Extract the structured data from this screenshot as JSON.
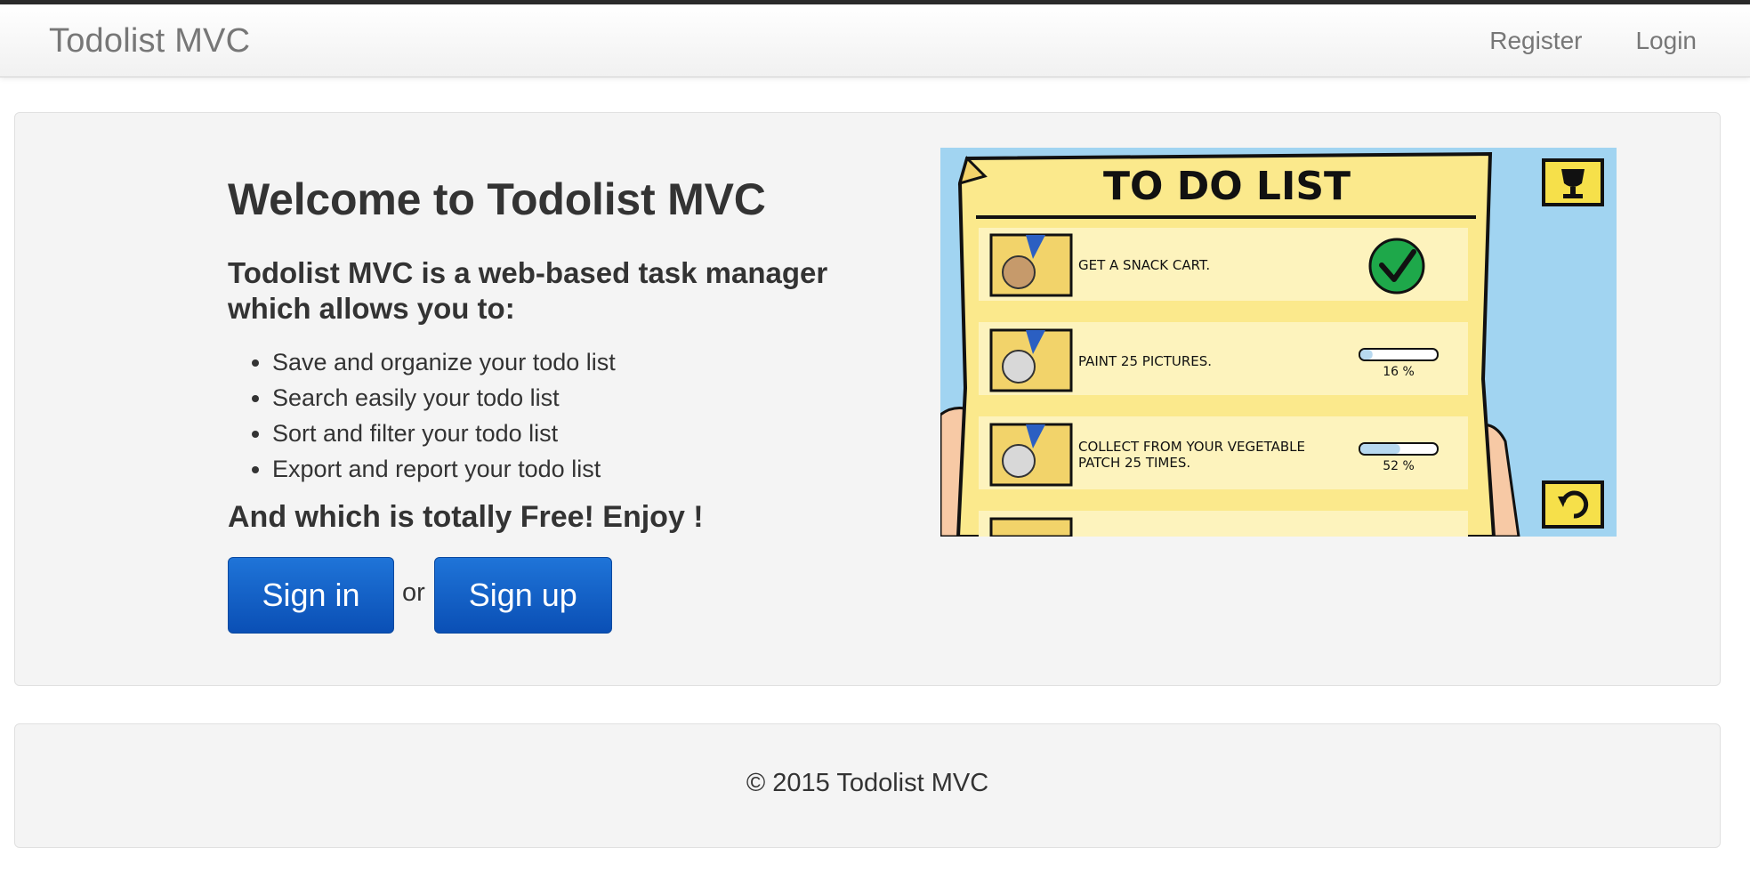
{
  "navbar": {
    "brand": "Todolist MVC",
    "links": [
      "Register",
      "Login"
    ]
  },
  "hero": {
    "title": "Welcome to Todolist MVC",
    "subtitle": "Todolist MVC is a web-based task manager which allows you to:",
    "features": [
      "Save and organize your todo list",
      "Search easily your todo list",
      "Sort and filter your todo list",
      "Export and report your todo list"
    ],
    "tagline": "And which is totally Free! Enjoy !",
    "signin_label": "Sign in",
    "or_label": "or",
    "signup_label": "Sign up"
  },
  "illustration": {
    "heading": "TO DO LIST",
    "items": [
      {
        "text": "GET A SNACK CART.",
        "status": "done"
      },
      {
        "text": "PAINT 25 PICTURES.",
        "progress_label": "16 %",
        "progress": 0.16
      },
      {
        "text_line1": "COLLECT FROM YOUR VEGETABLE",
        "text_line2": "PATCH 25 TIMES.",
        "progress_label": "52 %",
        "progress": 0.52
      }
    ],
    "icons": [
      "trophy-icon",
      "undo-icon",
      "checkmark-icon",
      "medal-icon"
    ],
    "colors": {
      "sky": "#a1d4f1",
      "paper": "#fbe98c",
      "row": "#fdf3bd",
      "check": "#1ea84a"
    }
  },
  "footer": {
    "text": "© 2015 Todolist MVC"
  },
  "theme": {
    "primary_button": "#0a56c0",
    "panel_bg": "#f4f4f4",
    "nav_text": "#777777"
  }
}
